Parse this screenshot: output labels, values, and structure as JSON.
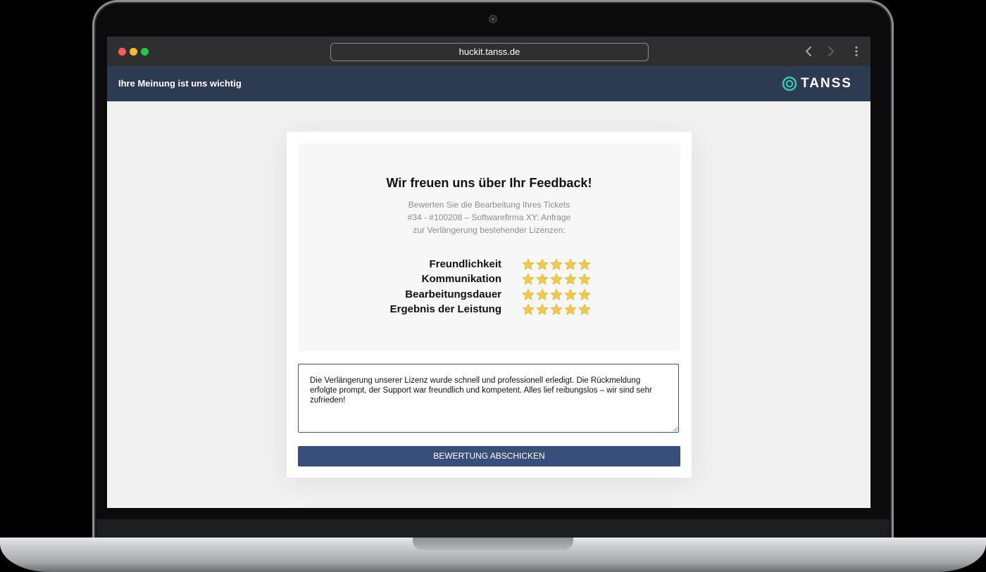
{
  "browser": {
    "url": "huckit.tanss.de"
  },
  "appbar": {
    "title": "Ihre Meinung ist uns wichtig",
    "logo_text": "TANSS"
  },
  "card": {
    "headline": "Wir freuen uns über Ihr Feedback!",
    "subtitle_lines": [
      "Bewerten Sie die Bearbeitung Ihres Tickets",
      "#34 - #100208 – Softwarefirma XY: Anfrage",
      "zur Verlängerung bestehender Lizenzen:"
    ],
    "ratings": [
      {
        "label": "Freundlichkeit",
        "stars": 5,
        "max": 5
      },
      {
        "label": "Kommunikation",
        "stars": 5,
        "max": 5
      },
      {
        "label": "Bearbeitungsdauer",
        "stars": 5,
        "max": 5
      },
      {
        "label": "Ergebnis der Leistung",
        "stars": 5,
        "max": 5
      }
    ],
    "feedback_text": "Die Verlängerung unserer Lizenz wurde schnell und professionell erledigt. Die Rückmeldung erfolgte prompt, der Support war freundlich und kompetent. Alles lief reibungslos – wir sind sehr zufrieden!",
    "submit_label": "BEWERTUNG ABSCHICKEN"
  },
  "colors": {
    "appbar": "#2c3a52",
    "button": "#384f7a",
    "star": "#f2c94c",
    "logo_mark": "#3fc1b0"
  },
  "icons": {
    "star": "star-icon",
    "back": "chevron-left-icon",
    "forward": "chevron-right-icon",
    "menu": "kebab-menu-icon"
  }
}
